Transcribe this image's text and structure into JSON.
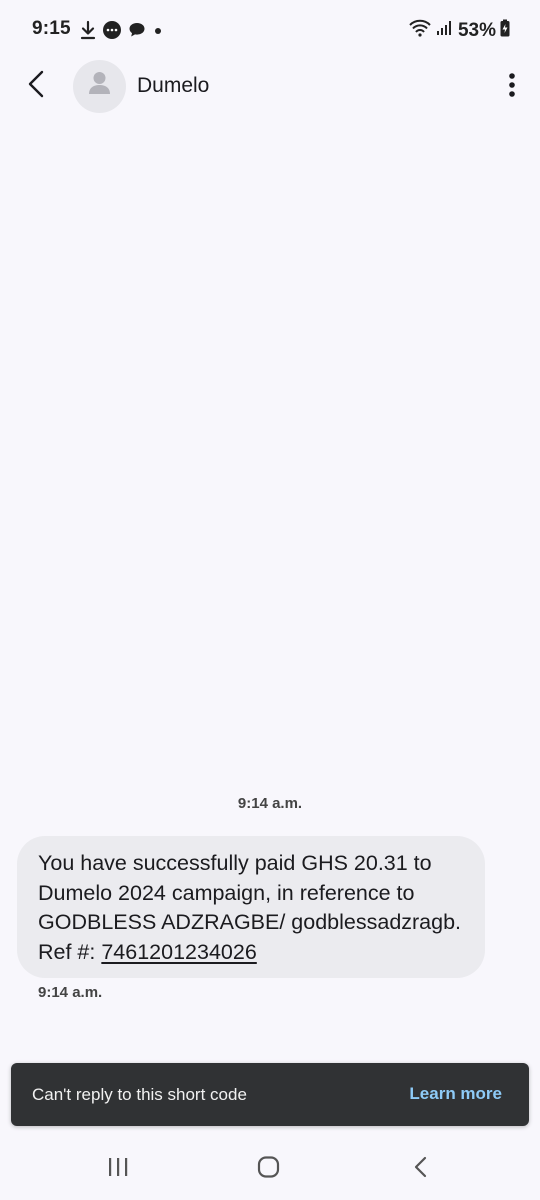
{
  "status_bar": {
    "time": "9:15",
    "battery_percent": "53%",
    "left_icons": [
      "download-icon",
      "message-bubble-icon",
      "chat-icon",
      "dot-icon"
    ],
    "right_icons": [
      "wifi-icon",
      "signal-icon",
      "battery-charging-icon"
    ]
  },
  "header": {
    "contact_name": "Dumelo",
    "back_icon": "chevron-left-icon",
    "avatar_icon": "person-icon",
    "more_icon": "more-vertical-icon"
  },
  "conversation": {
    "date_stamp": "9:14 a.m.",
    "messages": [
      {
        "text": "You have successfully paid GHS 20.31 to Dumelo 2024 campaign, in reference to GODBLESS ADZRAGBE/ godblessadzragb. Ref #: ",
        "link": "7461201234026",
        "time": "9:14 a.m."
      }
    ]
  },
  "snackbar": {
    "message": "Can't reply to this short code",
    "action": "Learn more",
    "action_color": "#8ecbf7"
  },
  "nav_bar": {
    "icons": [
      "recent-apps-icon",
      "home-icon",
      "back-nav-icon"
    ]
  },
  "colors": {
    "background": "#f8f7fc",
    "bubble": "#ebebef",
    "snackbar": "#303234"
  }
}
